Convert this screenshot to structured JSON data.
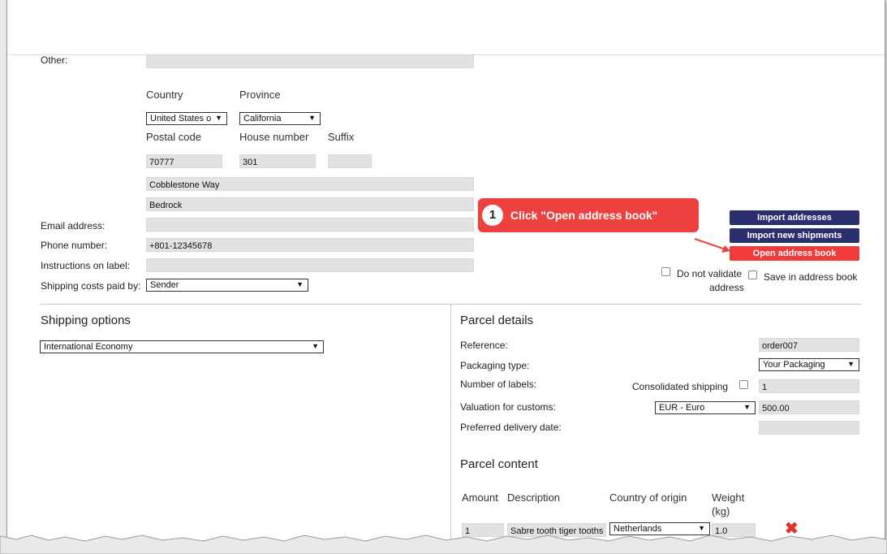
{
  "address": {
    "other_label": "Other:",
    "country_label": "Country",
    "province_label": "Province",
    "country_value": "United States o",
    "province_value": "California",
    "postal_code_label": "Postal code",
    "house_number_label": "House number",
    "suffix_label": "Suffix",
    "postal_code_value": "70777",
    "house_number_value": "301",
    "street_value": "Cobblestone Way",
    "city_value": "Bedrock",
    "email_label": "Email address:",
    "phone_label": "Phone number:",
    "phone_value": "+801-12345678",
    "instructions_label": "Instructions on label:",
    "shipping_paid_label": "Shipping costs paid by:",
    "shipping_paid_value": "Sender"
  },
  "actions": {
    "import_addresses": "Import addresses",
    "import_shipments": "Import new shipments",
    "open_address_book": "Open address book",
    "do_not_validate_line1": "Do not validate",
    "do_not_validate_line2": "address",
    "save_in_address_book": "Save in address book"
  },
  "callout": {
    "number": "1",
    "text": "Click \"Open address book\""
  },
  "shipping_options": {
    "title": "Shipping options",
    "service_value": "International Economy"
  },
  "parcel_details": {
    "title": "Parcel details",
    "reference_label": "Reference:",
    "reference_value": "order007",
    "packaging_label": "Packaging type:",
    "packaging_value": "Your Packaging",
    "labels_label": "Number of labels:",
    "consolidated_label": "Consolidated shipping",
    "labels_value": "1",
    "valuation_label": "Valuation for customs:",
    "currency_value": "EUR - Euro",
    "valuation_value": "500.00",
    "delivery_date_label": "Preferred delivery date:"
  },
  "parcel_content": {
    "title": "Parcel content",
    "col_amount": "Amount",
    "col_description": "Description",
    "col_country": "Country of origin",
    "col_weight_line1": "Weight",
    "col_weight_line2": "(kg)",
    "row_amount": "1",
    "row_description": "Sabre tooth tiger tooths",
    "row_country": "Netherlands",
    "row_weight": "1.0"
  },
  "icons": {
    "select_arrow": "▼",
    "delete": "✖"
  },
  "colors": {
    "navy_button": "#2c2f6e",
    "red_accent": "#f13b3b"
  }
}
